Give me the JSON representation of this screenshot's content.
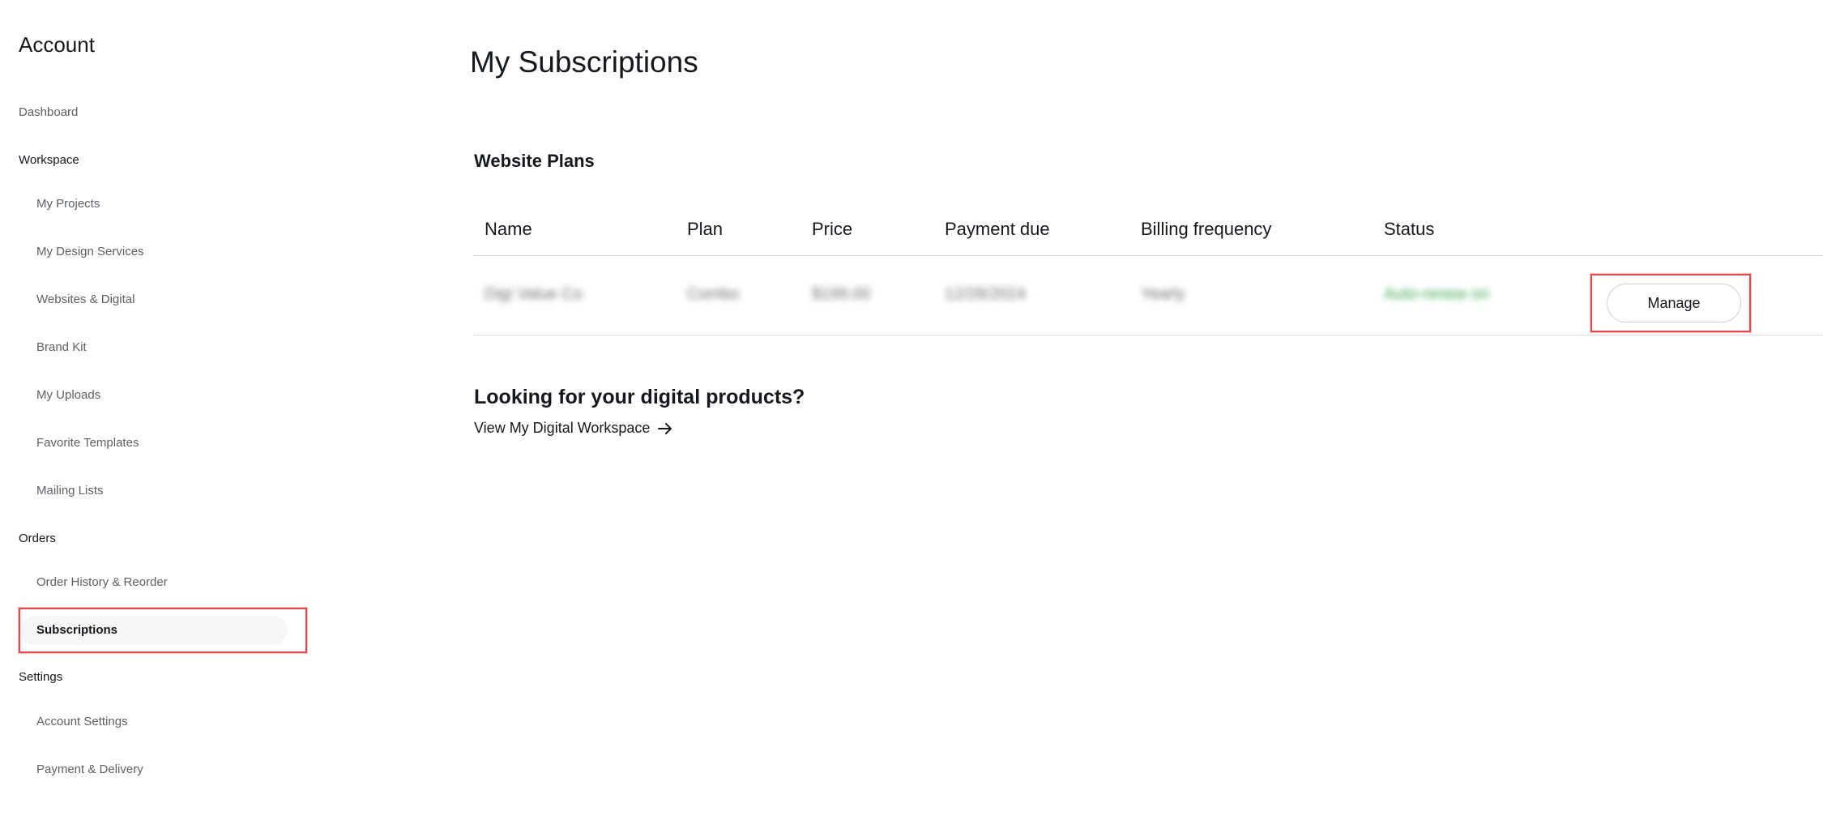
{
  "sidebar": {
    "title": "Account",
    "dashboard": "Dashboard",
    "workspace": {
      "label": "Workspace",
      "items": [
        "My Projects",
        "My Design Services",
        "Websites & Digital",
        "Brand Kit",
        "My Uploads",
        "Favorite Templates",
        "Mailing Lists"
      ]
    },
    "orders": {
      "label": "Orders",
      "items": [
        "Order History & Reorder",
        "Subscriptions"
      ]
    },
    "settings": {
      "label": "Settings",
      "items": [
        "Account Settings",
        "Payment & Delivery"
      ]
    }
  },
  "main": {
    "title": "My Subscriptions",
    "section_title": "Website Plans",
    "table": {
      "headers": [
        "Name",
        "Plan",
        "Price",
        "Payment due",
        "Billing frequency",
        "Status"
      ],
      "row": {
        "name": "Digi Value Co",
        "plan": "Combo",
        "price": "$199.00",
        "payment_due": "12/28/2024",
        "billing_frequency": "Yearly",
        "status": "Auto-renew on",
        "action": "Manage"
      }
    },
    "digital": {
      "title": "Looking for your digital products?",
      "link": "View My Digital Workspace"
    }
  },
  "colors": {
    "text": "#15191e",
    "muted": "#5c6166",
    "highlight": "#e5484d",
    "status": "#3aa550"
  },
  "icons": {
    "link_arrow": "arrow-right-icon"
  }
}
